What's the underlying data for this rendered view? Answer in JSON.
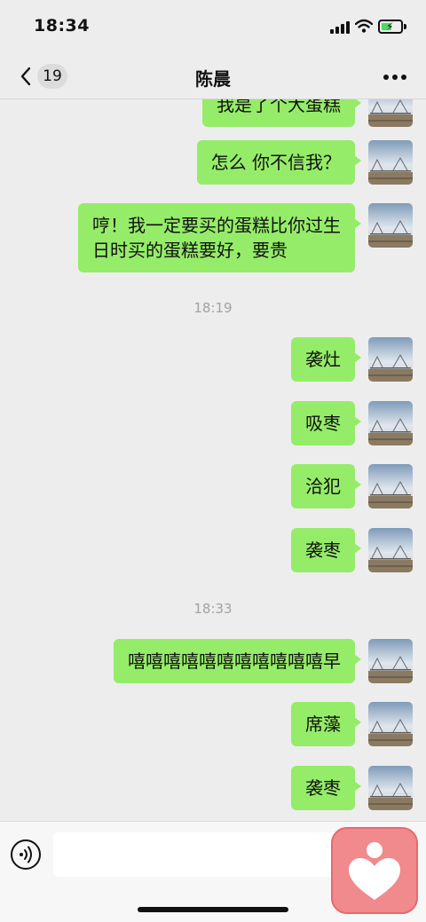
{
  "status_bar": {
    "time": "18:34"
  },
  "nav": {
    "back_count": "19",
    "title": "陈晨"
  },
  "messages": [
    {
      "type": "message",
      "text": "我是了个大蛋糕"
    },
    {
      "type": "message",
      "text": "怎么 你不信我？"
    },
    {
      "type": "message",
      "lines": [
        "哼！我一定要买的蛋糕比你过生",
        "日时买的蛋糕要好，要贵"
      ]
    },
    {
      "type": "timestamp",
      "text": "18:19"
    },
    {
      "type": "message",
      "text": "袭灶"
    },
    {
      "type": "message",
      "text": "吸枣"
    },
    {
      "type": "message",
      "text": "洽犯"
    },
    {
      "type": "message",
      "text": "袭枣"
    },
    {
      "type": "timestamp",
      "text": "18:33"
    },
    {
      "type": "message",
      "text": "嘻嘻嘻嘻嘻嘻嘻嘻嘻嘻嘻早"
    },
    {
      "type": "message",
      "text": "席藻"
    },
    {
      "type": "message",
      "text": "袭枣"
    }
  ],
  "input": {
    "value": ""
  },
  "colors": {
    "bubble": "#95ec69",
    "background": "#ededed",
    "floating_app": "#f08a8c"
  },
  "icons": [
    "back-icon",
    "more-icon",
    "voice-icon",
    "heart-app-icon",
    "signal-icon",
    "wifi-icon",
    "battery-icon"
  ]
}
